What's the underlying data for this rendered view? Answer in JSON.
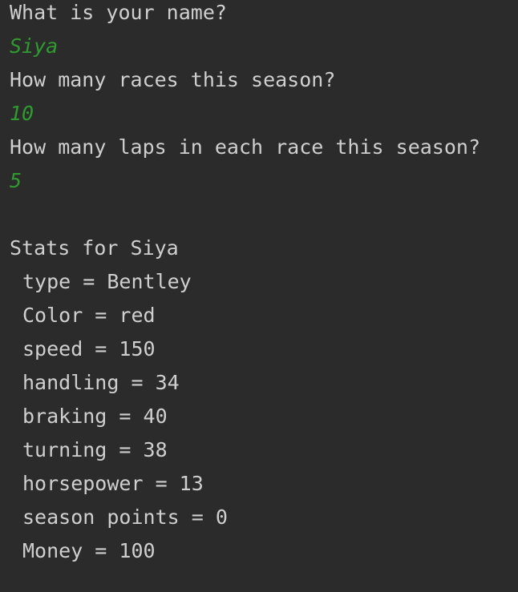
{
  "console": {
    "prompts": {
      "name_question": "What is your name?",
      "name_input": "Siya",
      "races_question": "How many races this season?",
      "races_input": "10",
      "laps_question": "How many laps in each race this season?",
      "laps_input": "5"
    },
    "stats_header": "Stats for Siya",
    "stats": [
      "type = Bentley",
      "Color = red",
      "speed = 150",
      "handling = 34",
      "braking = 40",
      "turning = 38",
      "horsepower = 13",
      "season points = 0",
      "Money = 100"
    ],
    "colors": {
      "background": "#2b2b2b",
      "output_text": "#cfcfcf",
      "user_input": "#2f9a2f"
    }
  }
}
